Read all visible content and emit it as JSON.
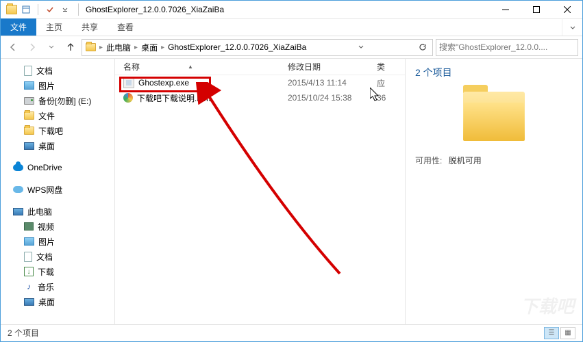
{
  "window": {
    "title": "GhostExplorer_12.0.0.7026_XiaZaiBa"
  },
  "ribbon": {
    "file": "文件",
    "tabs": [
      "主页",
      "共享",
      "查看"
    ]
  },
  "breadcrumb": {
    "segments": [
      "此电脑",
      "桌面",
      "GhostExplorer_12.0.0.7026_XiaZaiBa"
    ]
  },
  "search": {
    "placeholder": "搜索\"GhostExplorer_12.0.0...."
  },
  "navpane": {
    "items": [
      {
        "label": "文档",
        "icon": "doc",
        "level": 1
      },
      {
        "label": "图片",
        "icon": "pic",
        "level": 1
      },
      {
        "label": "备份[勿删] (E:)",
        "icon": "drive",
        "level": 1
      },
      {
        "label": "文件",
        "icon": "folder",
        "level": 1
      },
      {
        "label": "下载吧",
        "icon": "folder",
        "level": 1
      },
      {
        "label": "桌面",
        "icon": "monitor",
        "level": 1
      },
      {
        "label": "OneDrive",
        "icon": "cloud",
        "level": 0,
        "gap": true
      },
      {
        "label": "WPS网盘",
        "icon": "wps",
        "level": 0,
        "gap": true
      },
      {
        "label": "此电脑",
        "icon": "monitor",
        "level": 0,
        "gap": true
      },
      {
        "label": "视频",
        "icon": "video",
        "level": 1
      },
      {
        "label": "图片",
        "icon": "pic",
        "level": 1
      },
      {
        "label": "文档",
        "icon": "doc",
        "level": 1
      },
      {
        "label": "下载",
        "icon": "dl",
        "level": 1
      },
      {
        "label": "音乐",
        "icon": "music",
        "level": 1
      },
      {
        "label": "桌面",
        "icon": "monitor",
        "level": 1
      }
    ]
  },
  "columns": {
    "name": "名称",
    "date": "修改日期",
    "type": "类"
  },
  "files": [
    {
      "name": "Ghostexp.exe",
      "date": "2015/4/13 11:14",
      "type": "应",
      "icon": "exe"
    },
    {
      "name": "下载吧下载说明.htm",
      "date": "2015/10/24 15:38",
      "type": "36",
      "icon": "htm"
    }
  ],
  "details": {
    "title": "2 个项目",
    "avail_label": "可用性:",
    "avail_value": "脱机可用"
  },
  "status": {
    "text": "2 个项目"
  },
  "watermark": "下载吧"
}
